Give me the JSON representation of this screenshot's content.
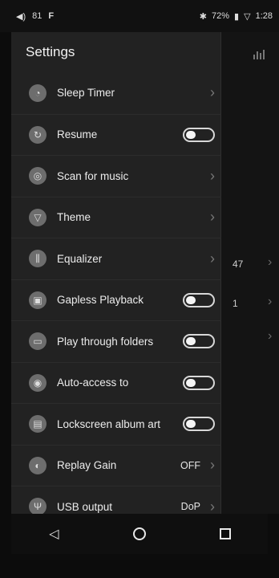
{
  "status": {
    "volume": "81",
    "battery": "72%",
    "time": "1:28"
  },
  "app_title": "Settings",
  "menu": [
    {
      "label": "Sleep Timer",
      "icon": "timer-icon",
      "control": "chevron"
    },
    {
      "label": "Resume",
      "icon": "resume-icon",
      "control": "toggle",
      "checked": false
    },
    {
      "label": "Scan for music",
      "icon": "scan-icon",
      "control": "chevron"
    },
    {
      "label": "Theme",
      "icon": "shirt-icon",
      "control": "chevron"
    },
    {
      "label": "Equalizer",
      "icon": "equalizer-icon",
      "control": "chevron"
    },
    {
      "label": "Gapless Playback",
      "icon": "gapless-icon",
      "control": "toggle",
      "checked": false
    },
    {
      "label": "Play through folders",
      "icon": "folder-icon",
      "control": "toggle",
      "checked": false
    },
    {
      "label": "Auto-access to",
      "icon": "auto-icon",
      "control": "toggle",
      "checked": false
    },
    {
      "label": "Lockscreen album art",
      "icon": "lockscreen-icon",
      "control": "toggle",
      "checked": false
    },
    {
      "label": "Replay Gain",
      "icon": "replay-gain-icon",
      "control": "value",
      "value": "OFF"
    },
    {
      "label": "USB output",
      "icon": "usb-icon",
      "control": "value",
      "value": "DoP"
    }
  ],
  "background": {
    "row1": "47",
    "row2": "1"
  }
}
